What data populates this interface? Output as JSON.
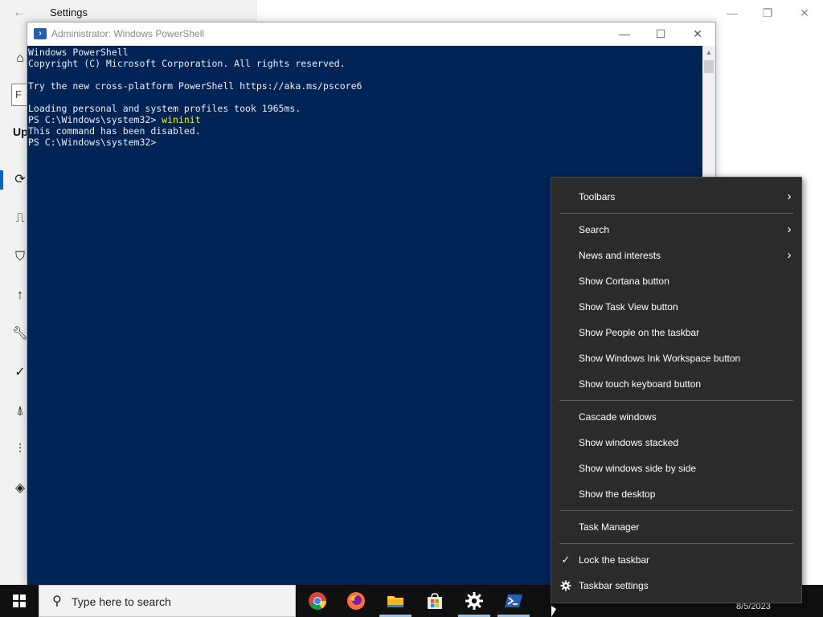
{
  "settings": {
    "title": "Settings",
    "partial_heading": "Up",
    "partial_search": "F"
  },
  "powershell": {
    "title": "Administrator: Windows PowerShell",
    "lines": {
      "l1": "Windows PowerShell",
      "l2": "Copyright (C) Microsoft Corporation. All rights reserved.",
      "l3": "Try the new cross-platform PowerShell https://aka.ms/pscore6",
      "l4": "Loading personal and system profiles took 1965ms.",
      "l5_prompt": "PS C:\\Windows\\system32> ",
      "l5_cmd": "wininit",
      "l6": "This command has been disabled.",
      "l7": "PS C:\\Windows\\system32>"
    }
  },
  "context_menu": {
    "items": [
      {
        "label": "Toolbars",
        "has_submenu": true
      },
      {
        "label": "Search",
        "has_submenu": true
      },
      {
        "label": "News and interests",
        "has_submenu": true
      },
      {
        "label": "Show Cortana button"
      },
      {
        "label": "Show Task View button"
      },
      {
        "label": "Show People on the taskbar"
      },
      {
        "label": "Show Windows Ink Workspace button"
      },
      {
        "label": "Show touch keyboard button"
      },
      {
        "label": "Cascade windows"
      },
      {
        "label": "Show windows stacked"
      },
      {
        "label": "Show windows side by side"
      },
      {
        "label": "Show the desktop"
      },
      {
        "label": "Task Manager"
      },
      {
        "label": "Lock the taskbar",
        "checked": true
      },
      {
        "label": "Taskbar settings",
        "icon": "gear-icon"
      }
    ]
  },
  "taskbar": {
    "search_placeholder": "Type here to search",
    "apps": [
      "chrome-icon",
      "firefox-icon",
      "file-explorer-icon",
      "microsoft-store-icon",
      "settings-gear-icon",
      "powershell-icon"
    ],
    "date": "8/5/2023"
  },
  "colors": {
    "console_bg": "#012456",
    "console_text": "#eeedf0",
    "console_cmd": "#f6f602",
    "menu_bg": "#2b2b2b",
    "taskbar_bg": "#101010"
  }
}
